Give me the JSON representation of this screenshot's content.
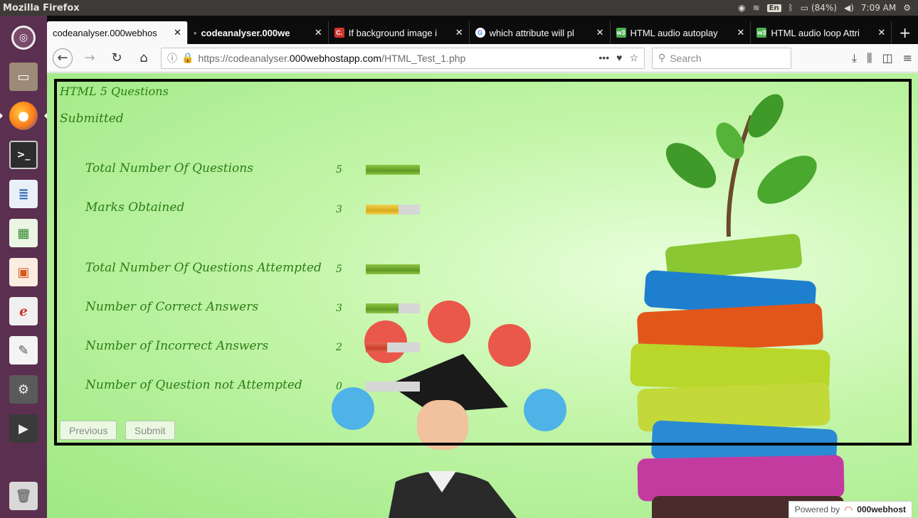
{
  "system": {
    "app_title": "Mozilla Firefox",
    "keyboard": "En",
    "battery": "(84%)",
    "clock": "7:09 AM"
  },
  "tabs": [
    {
      "title": "codeanalyser.000webhos",
      "favicon": ""
    },
    {
      "title": "codeanalyser.000we",
      "favicon": "",
      "prefix": "•"
    },
    {
      "title": "If background image i",
      "favicon": "C."
    },
    {
      "title": "which attribute will pl",
      "favicon": "G"
    },
    {
      "title": "HTML audio autoplay",
      "favicon": "w3"
    },
    {
      "title": "HTML audio loop Attri",
      "favicon": "w3"
    }
  ],
  "nav": {
    "url_prefix": "https://codeanalyser.",
    "url_domain": "000webhostapp.com",
    "url_path": "/HTML_Test_1.php",
    "search_placeholder": "Search"
  },
  "page": {
    "heading": "HTML 5 Questions",
    "status": "Submitted",
    "stats": [
      {
        "label": "Total Number Of Questions",
        "value": "5",
        "fill": 1.0,
        "color": "green"
      },
      {
        "label": "Marks Obtained",
        "value": "3",
        "fill": 0.6,
        "color": "yellow"
      },
      {
        "label": "Total Number Of Questions Attempted",
        "value": "5",
        "fill": 1.0,
        "color": "green"
      },
      {
        "label": "Number of Correct Answers",
        "value": "3",
        "fill": 0.6,
        "color": "green"
      },
      {
        "label": "Number of Incorrect Answers",
        "value": "2",
        "fill": 0.4,
        "color": "red"
      },
      {
        "label": "Number of Question not Attempted",
        "value": "0",
        "fill": 0.0,
        "color": "green"
      }
    ],
    "buttons": {
      "previous": "Previous",
      "submit": "Submit"
    }
  },
  "footer": {
    "powered_by": "Powered by",
    "brand": "000webhost"
  },
  "colors": {
    "accent_text": "#2c7d14",
    "bar_green": "#5f9a23",
    "bar_yellow": "#d9ab1b",
    "bar_red": "#c93e28",
    "launcher": "#5b2f4f"
  }
}
